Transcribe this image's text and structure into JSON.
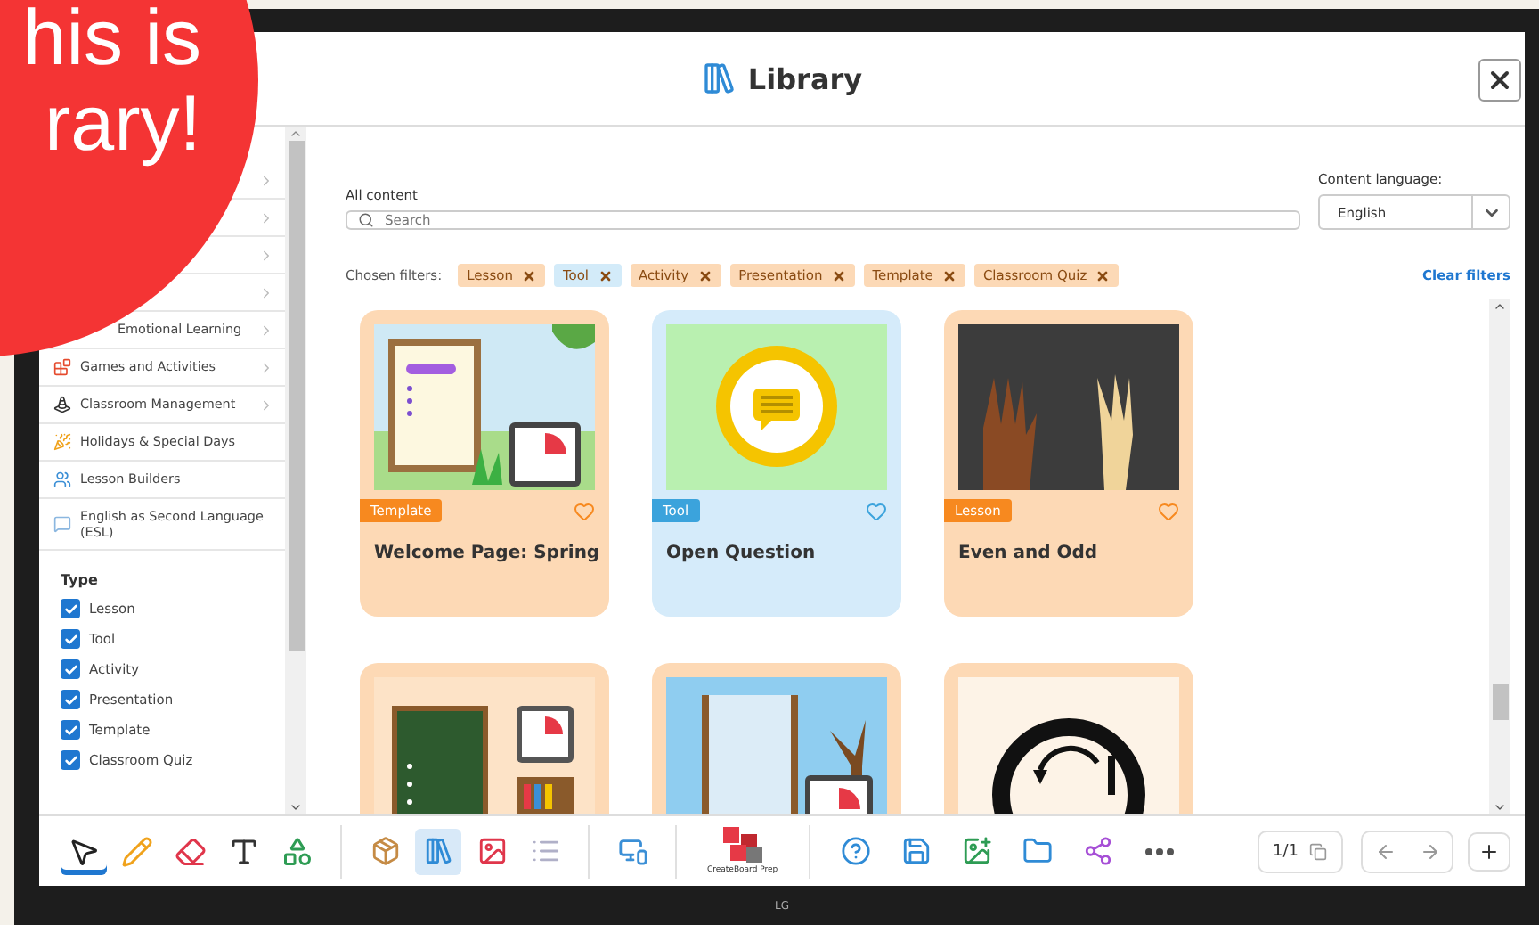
{
  "overlay": {
    "lines": [
      "his is",
      "rary!"
    ]
  },
  "header": {
    "title": "Library"
  },
  "sidebar": {
    "categories": [
      {
        "expandable": true
      },
      {
        "expandable": true
      },
      {
        "expandable": true
      },
      {
        "expandable": true
      },
      {
        "label": "Emotional Learning",
        "expandable": true
      },
      {
        "label": "Games and Activities",
        "expandable": true
      },
      {
        "label": "Classroom Management",
        "expandable": true
      },
      {
        "label": "Holidays & Special Days",
        "expandable": false
      },
      {
        "label": "Lesson Builders",
        "expandable": false
      },
      {
        "label": "English as Second Language (ESL)",
        "expandable": false
      }
    ],
    "type_heading": "Type",
    "types": [
      {
        "label": "Lesson",
        "checked": true
      },
      {
        "label": "Tool",
        "checked": true
      },
      {
        "label": "Activity",
        "checked": true
      },
      {
        "label": "Presentation",
        "checked": true
      },
      {
        "label": "Template",
        "checked": true
      },
      {
        "label": "Classroom Quiz",
        "checked": true
      }
    ]
  },
  "search": {
    "label": "All content",
    "placeholder": "Search"
  },
  "language": {
    "label": "Content language:",
    "value": "English"
  },
  "filters": {
    "label": "Chosen filters:",
    "clear": "Clear filters",
    "chips": [
      {
        "label": "Lesson",
        "color": "#fcd9b6"
      },
      {
        "label": "Tool",
        "color": "#d3ebf9"
      },
      {
        "label": "Activity",
        "color": "#fcd9b6"
      },
      {
        "label": "Presentation",
        "color": "#fcd9b6"
      },
      {
        "label": "Template",
        "color": "#fcd9b6"
      },
      {
        "label": "Classroom Quiz",
        "color": "#fcd9b6"
      }
    ]
  },
  "cards": [
    {
      "kind": "template",
      "tag": "Template",
      "title": "Welcome Page: Spring",
      "color": "#fdd9b5",
      "favorite": false
    },
    {
      "kind": "tool",
      "tag": "Tool",
      "title": "Open Question",
      "color": "#d5ebfa",
      "favorite": false
    },
    {
      "kind": "lesson",
      "tag": "Lesson",
      "title": "Even and Odd",
      "color": "#fdd9b5",
      "favorite": false
    },
    {
      "color": "#fdd9b5"
    },
    {
      "color": "#fdd9b5"
    },
    {
      "color": "#fdd9b5"
    }
  ],
  "toolbar": {
    "tools": [
      {
        "selected": true
      },
      {
        "selected": false
      },
      {
        "selected": false
      },
      {
        "selected": false
      },
      {
        "selected": false
      }
    ],
    "panels": [
      {
        "open": false
      },
      {
        "open": true
      },
      {
        "open": false
      },
      {
        "open": false
      }
    ],
    "logo_text": "CreateBoard Prep",
    "page": "1/1"
  },
  "bezel": {
    "brand": "LG"
  }
}
